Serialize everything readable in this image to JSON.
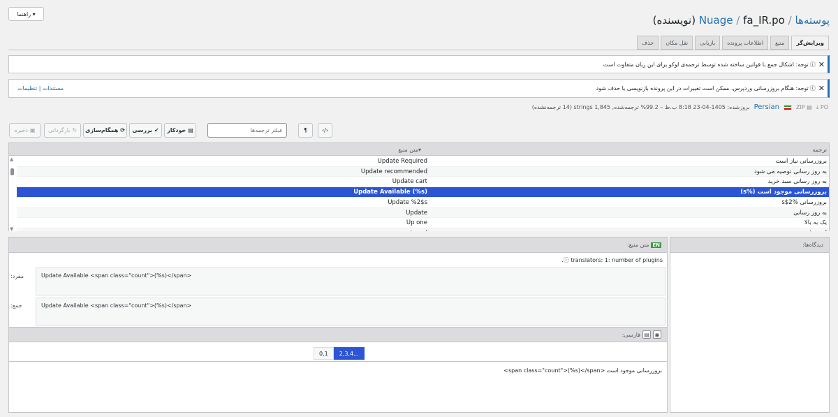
{
  "help_button": "راهنما ▾",
  "title": {
    "crumb_posts": "پوسته‌ها",
    "sep1": " / ",
    "crumb_theme": "Nuage",
    "sep2": " / ",
    "file": "fa_IR.po (نویسنده)"
  },
  "tabs": [
    "ویرایش‌گر",
    "منبع",
    "اطلاعات پرونده",
    "بازیابی",
    "نقل مکان",
    "حذف"
  ],
  "notices": {
    "plural": "توجه: اشکال جمع با قوانین ساخته شده توسط ترجمه‌ی لوکو برای این زبان متفاوت است",
    "update": "توجه: هنگام بروزرسانی وردپرس، ممکن است تغییرات در این پرونده بازنویسی یا حذف شود",
    "link_docs": "مستندات",
    "link_sep": " | ",
    "link_settings": "تنظیمات"
  },
  "meta": {
    "po": "PO ⤓",
    "zip": "ZIP",
    "language": "Persian",
    "stats": "بروزشده: 1405-04-23 8:18 ب.ظ – 99.2% ترجمه‌شده, 1,845 strings (14 ترجمه‌نشده)"
  },
  "toolbar": {
    "save": "ذخیره",
    "revert": "بازگردانی",
    "sync": "همگام‌سازی",
    "check": "بررسی",
    "auto": "خودکار",
    "filter_placeholder": "فیلتر ترجمه‌ها",
    "pilcrow": "¶",
    "code": "‹/›"
  },
  "grid": {
    "col_source": "متن منبع",
    "col_translation": "ترجمه",
    "rows": [
      {
        "source": "Update Required",
        "translation": "بروزرسانی نیاز است"
      },
      {
        "source": "Update recommended",
        "translation": "به روز رسانی توصیه می شود"
      },
      {
        "source": "Update cart",
        "translation": "به روز رسانی سبد خرید"
      },
      {
        "source": "Update Available (%s)",
        "translation": "بروزرسانی موجود است (%s)"
      },
      {
        "source": "Update %2$s",
        "translation": "بروزرسانی %2$s"
      },
      {
        "source": "Update",
        "translation": "به روز رسانی"
      },
      {
        "source": "Up one",
        "translation": "یک به بالا"
      },
      {
        "source": "untappd",
        "translation": "untappd"
      }
    ]
  },
  "editor": {
    "source_label": "متن منبع:",
    "en_badge": "EN",
    "note": "translators: 1: number of plugins.",
    "singular_label": "مفرد:",
    "singular": "Update Available <span class=\"count\">(%s)</span>",
    "plural_label": "جمع:",
    "plural": "Update Available <span class=\"count\">(%s)</span>",
    "farsi_label": "فارسی:",
    "plural_tab_1": "0,1",
    "plural_tab_2": "2,3,4...",
    "translation": "بروزرسانی موجود است <span class=\"count\">(%s)</span>"
  },
  "comments": {
    "label": "دیدگاه‌ها:"
  }
}
